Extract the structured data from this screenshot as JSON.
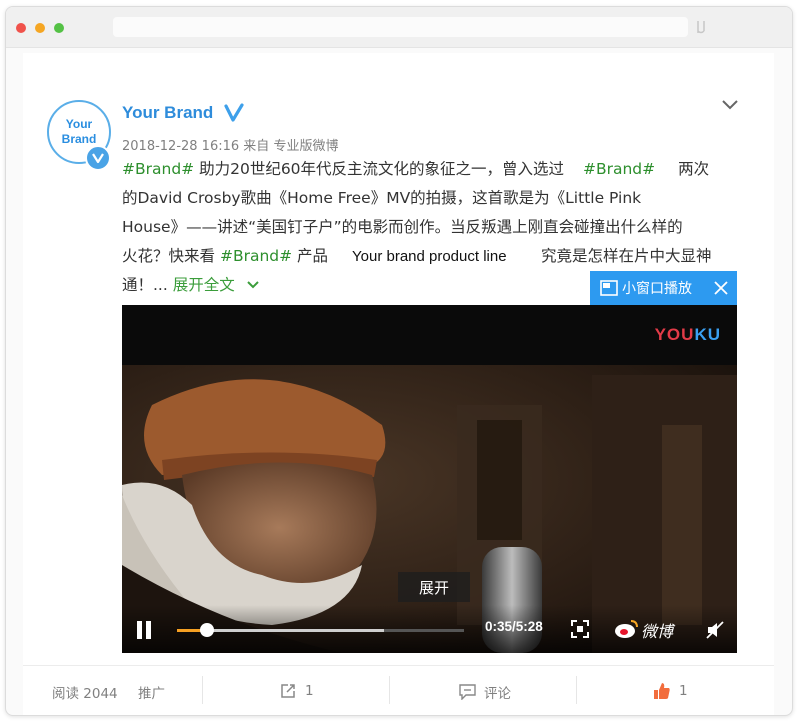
{
  "post": {
    "username": "Your Brand",
    "avatar_text": "Your Brand",
    "date": "2018-12-28 16:16",
    "source_prefix": "来自",
    "source": "专业版微博",
    "lines": {
      "l1_tag": "#Brand#",
      "l1_text": "助力20世纪60年代反主流文化的象征之一，曾入选过",
      "l1_tag2": "#Brand#",
      "l1_text2": "两次",
      "l2_text": "的David Crosby歌曲《Home Free》MV的拍摄，这首歌是为《Little Pink",
      "l3_text": "House》——讲述“美国钉子户”的电影而创作。当反叛遇上刚直会碰撞出什么样的",
      "l4_text_a": "火花？快来看",
      "l4_tag": "#Brand#",
      "l4_text_b": "产品",
      "l4_text_c": "究竟是怎样在片中大显神",
      "l5_text": "通！...",
      "l5_expand": "展开全文"
    },
    "brand_product_line": "Your brand product line"
  },
  "video": {
    "mini_player_label": "小窗口播放",
    "youku_logo": "YOUKU",
    "overlay_expand": "展开",
    "time": "0:35/5:28",
    "progress_fraction": 0.106,
    "buffered_fraction": 0.72,
    "weibo_label": "微博"
  },
  "footer": {
    "reads_label": "阅读 2044",
    "promote_label": "推广",
    "share_count": "1",
    "comment_label": "评论",
    "like_count": "1"
  },
  "colors": {
    "brand_blue": "#2e8cdb",
    "tag_green": "#2d8f2d",
    "mini_player_blue": "#2d9af0",
    "progress_orange": "#f6a023",
    "like_orange": "#f26d3d"
  }
}
